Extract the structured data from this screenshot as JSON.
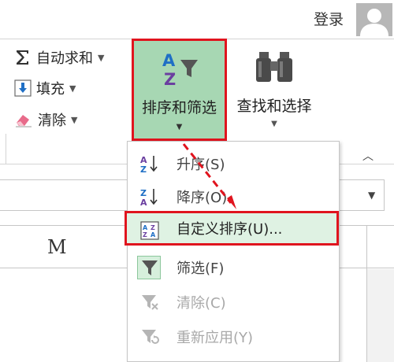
{
  "header": {
    "login_label": "登录"
  },
  "editing": {
    "autosum_label": "自动求和",
    "fill_label": "填充",
    "clear_label": "清除",
    "sort_filter_label": "排序和筛选",
    "find_select_label": "查找和选择"
  },
  "sheet": {
    "column_label": "M"
  },
  "menu": {
    "items": [
      {
        "label": "升序(S)",
        "enabled": true
      },
      {
        "label": "降序(O)",
        "enabled": true
      },
      {
        "label": "自定义排序(U)...",
        "enabled": true,
        "highlighted": true
      },
      {
        "label": "筛选(F)",
        "enabled": true
      },
      {
        "label": "清除(C)",
        "enabled": false
      },
      {
        "label": "重新应用(Y)",
        "enabled": false
      }
    ]
  },
  "colors": {
    "highlight_border": "#e0141e",
    "button_active_bg": "#a7d7b3",
    "menu_highlight_bg": "#dff2e3",
    "sort_icon_purple": "#6b3fa0",
    "sort_icon_blue": "#1f6fc5"
  },
  "icons": {
    "autosum": "sigma-icon",
    "fill": "fill-down-arrow-icon",
    "clear": "eraser-icon",
    "sort_filter": "sort-az-filter-icon",
    "find": "binoculars-icon",
    "ascending": "sort-ascending-icon",
    "descending": "sort-descending-icon",
    "custom_sort": "custom-sort-icon",
    "filter": "filter-funnel-icon",
    "clear_filter": "clear-filter-icon",
    "reapply": "reapply-filter-icon"
  }
}
